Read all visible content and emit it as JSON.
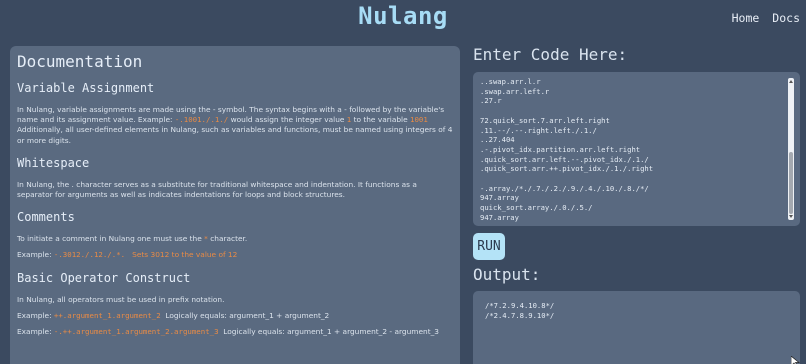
{
  "app": {
    "title": "Nulang"
  },
  "nav": {
    "home": "Home",
    "docs": "Docs"
  },
  "docs": {
    "title": "Documentation",
    "variable": {
      "heading": "Variable Assignment",
      "t1": "In Nulang, variable assignments are made using the - symbol. The syntax begins with a - followed by the variable's name and its assignment value. Example: ",
      "code1": "-.1001./.1./",
      "t2": " would assign the integer value ",
      "val1": "1",
      "t3": " to the variable ",
      "var1": "1001",
      "t4": " Additionally, all user-defined elements in Nulang, such as variables and functions, must be named using integers of 4 or more digits."
    },
    "whitespace": {
      "heading": "Whitespace",
      "t1": "In Nulang, the . character serves as a substitute for traditional whitespace and indentation. It functions as a separator for arguments as well as indicates indentations for loops and block structures."
    },
    "comments": {
      "heading": "Comments",
      "t1": "To initiate a comment in Nulang one must use the ",
      "star": "*",
      "t2": " character.",
      "ex_label": "Example: ",
      "ex_code": "-.3012./.12./.*.",
      "ex_sp": "   ",
      "ex_note": "Sets 3012 to the value of 12"
    },
    "operator": {
      "heading": "Basic Operator Construct",
      "t1": "In Nulang, all operators must be used in prefix notation.",
      "ex1_label": "Example: ",
      "ex1_code": "++.argument_1.argument_2",
      "ex1_note": "  Logically equals: argument_1 + argument_2",
      "ex2_label": "Example: ",
      "ex2_code": "-.++.argument_1.argument_2.argument_3",
      "ex2_note": "  Logically equals: argument_1 + argument_2 - argument_3"
    }
  },
  "editor": {
    "heading": "Enter Code Here:",
    "lines": [
      "..swap.arr.l.r",
      ".swap.arr.left.r",
      ".27.r",
      "",
      "72.quick_sort.7.arr.left.right",
      ".11.--/.--.right.left./.1./",
      "..27.404",
      ".-.pivot_idx.partition.arr.left.right",
      ".quick_sort.arr.left.--.pivot_idx./.1./",
      ".quick_sort.arr.++.pivot_idx./.1./.right",
      "",
      "-.array./*./.7./.2./.9./.4./.10./.8./*/",
      "947.array",
      "quick_sort.array./.0./.5./",
      "947.array"
    ]
  },
  "run": {
    "label": "RUN"
  },
  "output": {
    "heading": "Output:",
    "lines": [
      "/*7.2.9.4.10.8*/",
      "/*2.4.7.8.9.10*/"
    ]
  },
  "icons": {
    "scroll_up": "triangle-up-icon",
    "scroll_down": "triangle-down-icon",
    "resize": "resize-grip-icon",
    "cursor": "mouse-pointer-icon"
  }
}
